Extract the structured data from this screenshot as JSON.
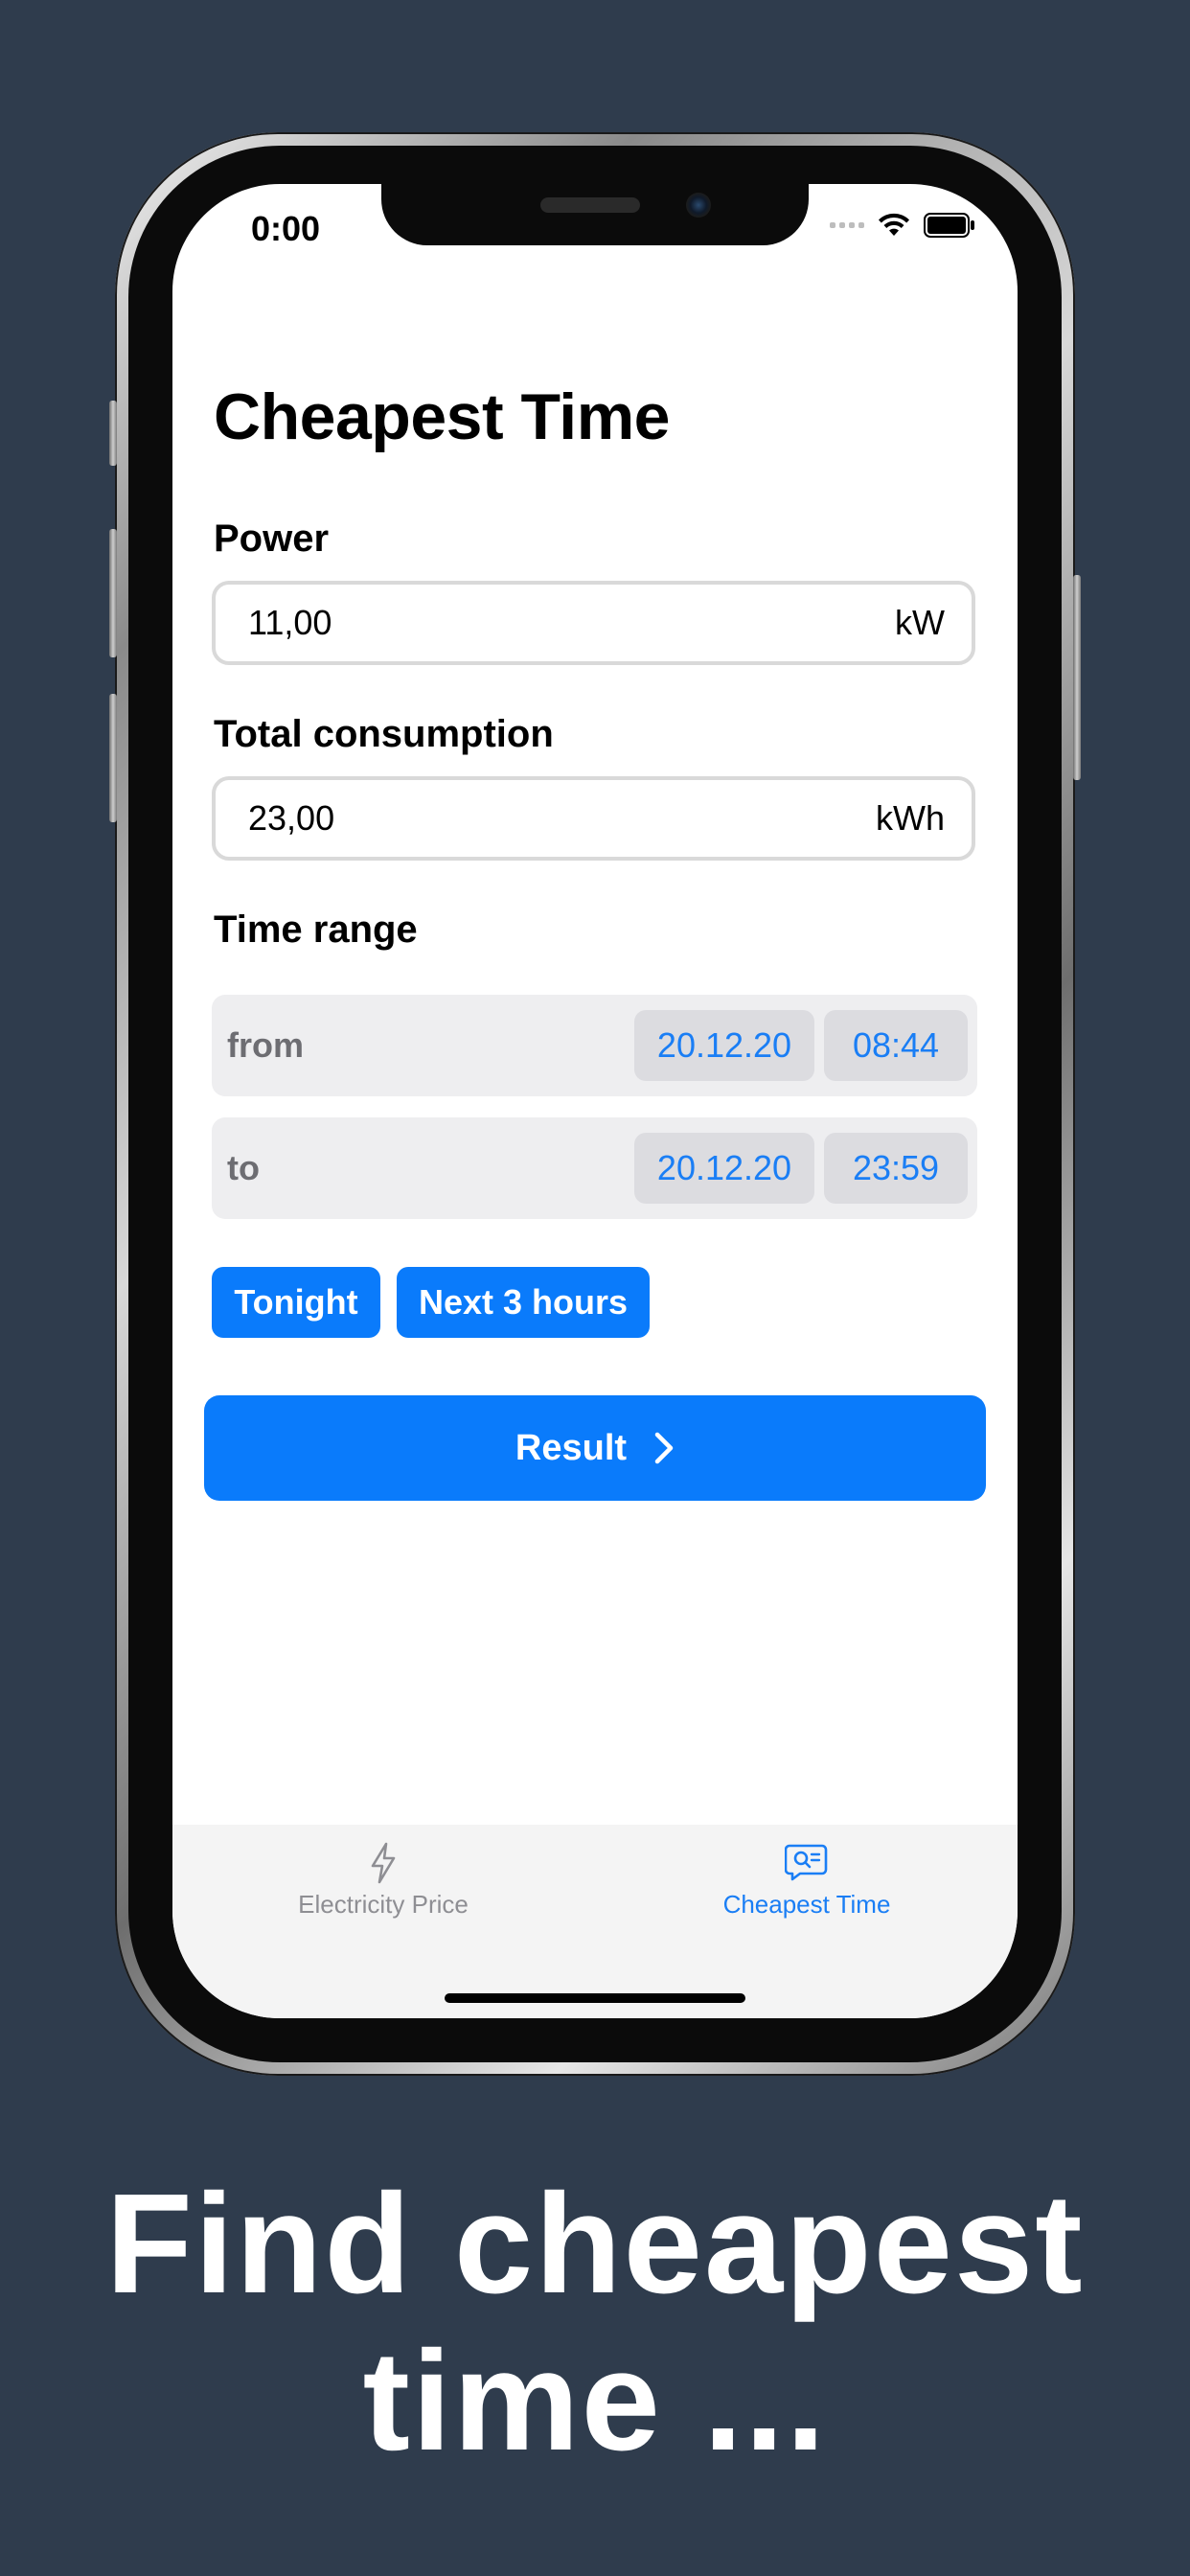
{
  "status_bar": {
    "time": "0:00"
  },
  "page": {
    "title": "Cheapest Time"
  },
  "power": {
    "label": "Power",
    "value": "11,00",
    "unit": "kW"
  },
  "consumption": {
    "label": "Total consumption",
    "value": "23,00",
    "unit": "kWh"
  },
  "time_range": {
    "label": "Time range",
    "from": {
      "label": "from",
      "date": "20.12.20",
      "time": "08:44"
    },
    "to": {
      "label": "to",
      "date": "20.12.20",
      "time": "23:59"
    }
  },
  "quick_buttons": {
    "tonight": "Tonight",
    "next3": "Next 3 hours"
  },
  "result_button": {
    "label": "Result"
  },
  "tabs": [
    {
      "label": "Electricity Price",
      "icon": "bolt-icon",
      "active": false
    },
    {
      "label": "Cheapest Time",
      "icon": "search-bubble-icon",
      "active": true
    }
  ],
  "colors": {
    "accent": "#0a7bfb",
    "background": "#2f3c4d",
    "inactive_tab": "#8e8e93"
  },
  "caption": {
    "line1": "Find cheapest",
    "line2": "time ..."
  }
}
